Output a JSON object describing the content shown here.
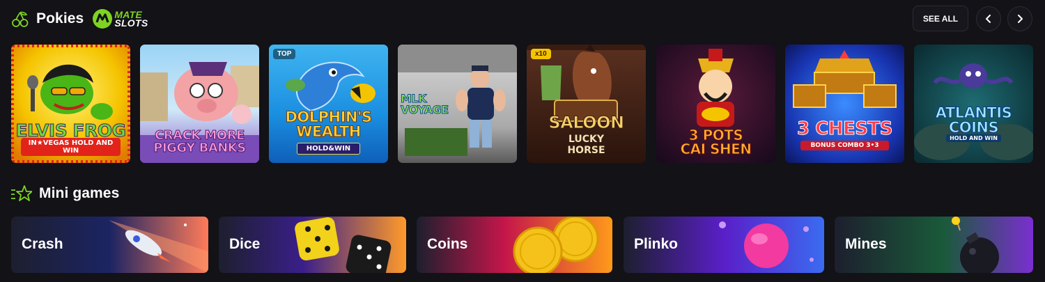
{
  "pokies": {
    "title": "Pokies",
    "brand_line1": "MATE",
    "brand_line2": "SLOTS",
    "see_all_label": "SEE ALL",
    "games": [
      {
        "title": "Elvis Frog",
        "subtitle": "IN★VEGAS HOLD AND WIN",
        "badge": ""
      },
      {
        "title": "Crack More Piggy Banks",
        "subtitle": "",
        "badge": ""
      },
      {
        "title": "Dolphin's Wealth",
        "subtitle": "HOLD&WIN",
        "badge": "TOP"
      },
      {
        "title": "MLK Voyage",
        "subtitle": "",
        "badge": ""
      },
      {
        "title": "Saloon",
        "subtitle": "LUCKY HORSE",
        "badge": "x10"
      },
      {
        "title": "3 Pots Cai Shen",
        "subtitle": "",
        "badge": ""
      },
      {
        "title": "3 Chests",
        "subtitle": "BONUS COMBO 3•3",
        "badge": ""
      },
      {
        "title": "Atlantis Coins",
        "subtitle": "HOLD AND WIN",
        "badge": ""
      }
    ]
  },
  "mini_games": {
    "title": "Mini games",
    "items": [
      {
        "label": "Crash"
      },
      {
        "label": "Dice"
      },
      {
        "label": "Coins"
      },
      {
        "label": "Plinko"
      },
      {
        "label": "Mines"
      }
    ]
  },
  "colors": {
    "background": "#121217",
    "accent_green": "#7ed321",
    "button_bg": "#16161c",
    "button_border": "#2c2c35"
  },
  "icons": {
    "pokies_icon": "cherries-icon",
    "mini_games_icon": "star-icon",
    "prev_icon": "chevron-left-icon",
    "next_icon": "chevron-right-icon"
  }
}
